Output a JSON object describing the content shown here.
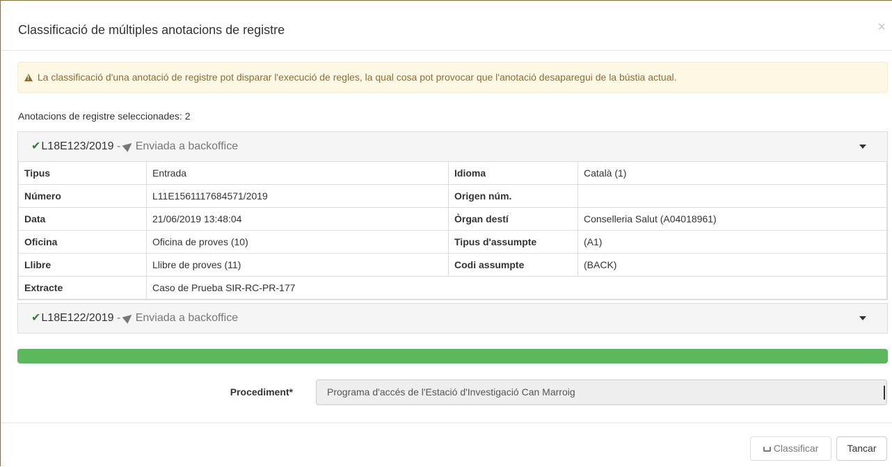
{
  "modal": {
    "title": "Classificació de múltiples anotacions de registre",
    "close_symbol": "×"
  },
  "alert": {
    "icon": "warning-icon",
    "text": "La classificació d'una anotació de registre pot disparar l'execució de regles, la qual cosa pot provocar que l'anotació desaparegui de la bústia actual."
  },
  "selected_label": "Anotacions de registre seleccionades: 2",
  "annotations": [
    {
      "code": "L18E123/2019",
      "separator": " - ",
      "state": "Enviada a backoffice",
      "expanded": true,
      "rows": [
        {
          "l1": "Tipus",
          "v1": "Entrada",
          "l2": "Idioma",
          "v2": "Català (1)"
        },
        {
          "l1": "Número",
          "v1": "L11E1561117684571/2019",
          "l2": "Origen núm.",
          "v2": ""
        },
        {
          "l1": "Data",
          "v1": "21/06/2019 13:48:04",
          "l2": "Òrgan destí",
          "v2": "Conselleria Salut (A04018961)"
        },
        {
          "l1": "Oficina",
          "v1": "Oficina de proves (10)",
          "l2": "Tipus d'assumpte",
          "v2": "(A1)"
        },
        {
          "l1": "Llibre",
          "v1": "Llibre de proves (11)",
          "l2": "Codi assumpte",
          "v2": "(BACK)"
        }
      ],
      "extract_label": "Extracte",
      "extract_value": "Caso de Prueba SIR-RC-PR-177"
    },
    {
      "code": "L18E122/2019",
      "separator": " - ",
      "state": "Enviada a backoffice",
      "expanded": false
    }
  ],
  "progress": {
    "percent": 100,
    "color": "#5cb85c"
  },
  "form": {
    "procediment_label": "Procediment*",
    "procediment_value": "Programa d'accés de l'Estació d'Investigació Can Marroig"
  },
  "footer": {
    "classify_label": "Classificar",
    "close_label": "Tancar"
  }
}
